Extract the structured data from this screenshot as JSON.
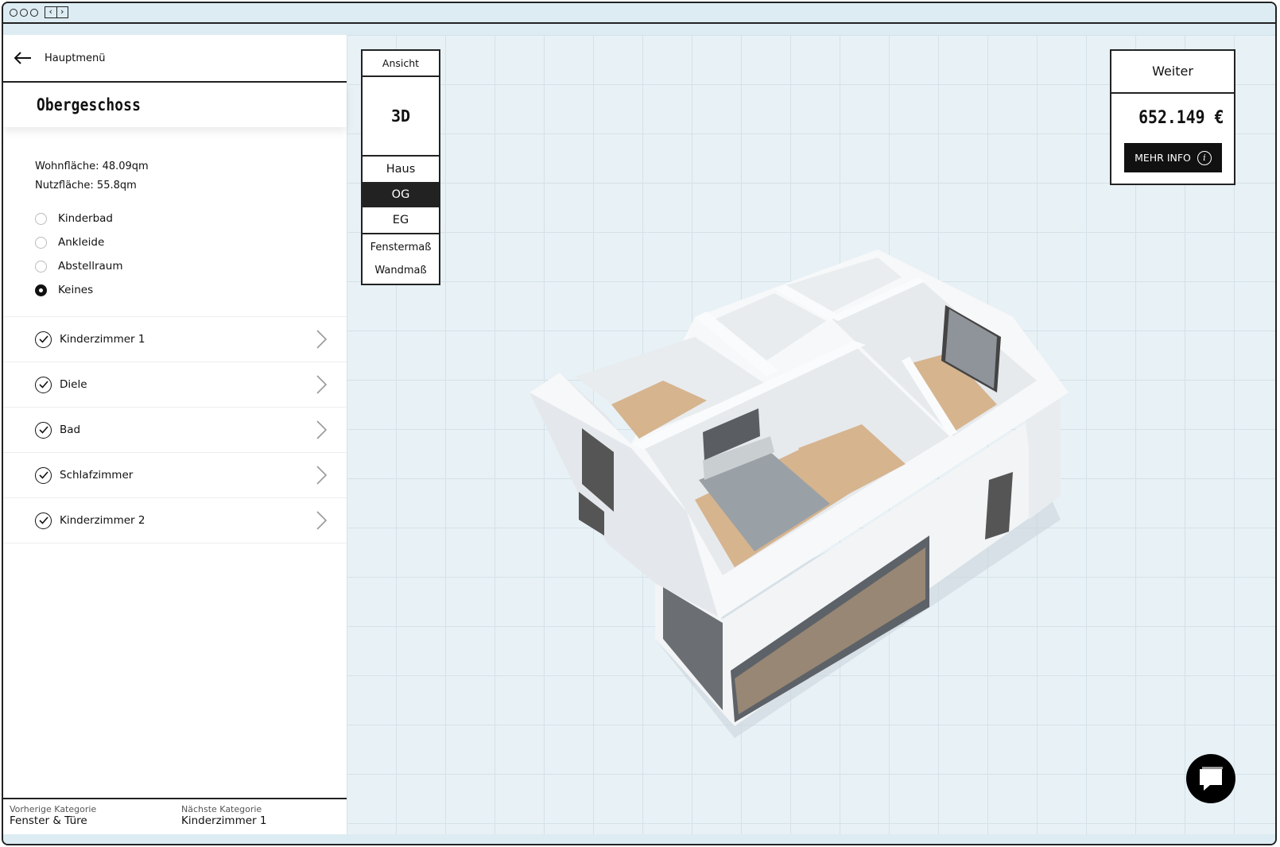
{
  "window": {
    "nav_glyphs": "‹›"
  },
  "sidebar": {
    "back_label": "Hauptmenü",
    "title": "Obergeschoss",
    "wohnflaeche": "Wohnfläche: 48.09qm",
    "nutzflaeche": "Nutzfläche: 55.8qm",
    "options": [
      {
        "label": "Kinderbad",
        "selected": false
      },
      {
        "label": "Ankleide",
        "selected": false
      },
      {
        "label": "Abstellraum",
        "selected": false
      },
      {
        "label": "Keines",
        "selected": true
      }
    ],
    "rooms": [
      {
        "label": "Kinderzimmer 1"
      },
      {
        "label": "Diele"
      },
      {
        "label": "Bad"
      },
      {
        "label": "Schlafzimmer"
      },
      {
        "label": "Kinderzimmer 2"
      }
    ],
    "footer": {
      "prev_small": "Vorherige Kategorie",
      "prev_big": "Fenster & Türe",
      "next_small": "Nächste Kategorie",
      "next_big": "Kinderzimmer 1"
    }
  },
  "view": {
    "header": "Ansicht",
    "mode": "3D",
    "levels": [
      "Haus",
      "OG",
      "EG"
    ],
    "active_level": "OG",
    "extras": [
      "Fenstermaß",
      "Wandmaß"
    ]
  },
  "price": {
    "next_label": "Weiter",
    "amount": "652.149 €",
    "info_label": "MEHR INFO",
    "info_glyph": "i"
  },
  "colors": {
    "accent": "#111111",
    "background": "#e8f1f5",
    "floor": "#d6b48e"
  },
  "icons": [
    "back-arrow-icon",
    "check-circle-icon",
    "chevron-right-icon",
    "info-icon",
    "chat-icon"
  ]
}
